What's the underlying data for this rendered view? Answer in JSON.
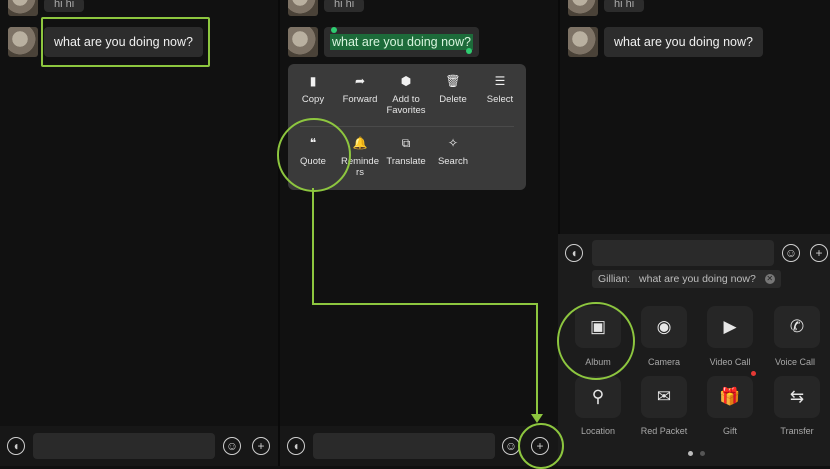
{
  "message_partial": "hi hi",
  "message_text": "what are you doing now?",
  "context_menu": {
    "row1": [
      {
        "label": "Copy",
        "icon": "copy-icon",
        "glyph": "▮"
      },
      {
        "label": "Forward",
        "icon": "forward-icon",
        "glyph": "➦"
      },
      {
        "label": "Add to Favorites",
        "icon": "favorites-cube-icon",
        "glyph": "⬢"
      },
      {
        "label": "Delete",
        "icon": "trash-icon",
        "glyph": "🗑"
      },
      {
        "label": "Select",
        "icon": "select-list-icon",
        "glyph": "☰"
      }
    ],
    "row2": [
      {
        "label": "Quote",
        "icon": "quote-icon",
        "glyph": "❝"
      },
      {
        "label": "Reminders",
        "icon": "bell-icon",
        "glyph": "🔔"
      },
      {
        "label": "Translate",
        "icon": "translate-icon",
        "glyph": "⧉"
      },
      {
        "label": "Search",
        "icon": "search-sparkle-icon",
        "glyph": "✧"
      }
    ]
  },
  "quote_preview": {
    "sender": "Gillian:",
    "text": "what are you doing now?"
  },
  "attachments": {
    "row1": [
      {
        "label": "Album",
        "icon": "album-icon",
        "glyph": "▣"
      },
      {
        "label": "Camera",
        "icon": "camera-icon",
        "glyph": "◉"
      },
      {
        "label": "Video Call",
        "icon": "video-call-icon",
        "glyph": "▶"
      },
      {
        "label": "Voice Call",
        "icon": "phone-icon",
        "glyph": "✆"
      }
    ],
    "row2": [
      {
        "label": "Location",
        "icon": "location-pin-icon",
        "glyph": "⚲"
      },
      {
        "label": "Red Packet",
        "icon": "red-packet-icon",
        "glyph": "✉"
      },
      {
        "label": "Gift",
        "icon": "gift-icon",
        "glyph": "🎁"
      },
      {
        "label": "Transfer",
        "icon": "transfer-icon",
        "glyph": "⇆"
      }
    ]
  },
  "colors": {
    "highlight": "#8dc63f",
    "selection": "#1d6b3a",
    "badge": "#e53935"
  }
}
